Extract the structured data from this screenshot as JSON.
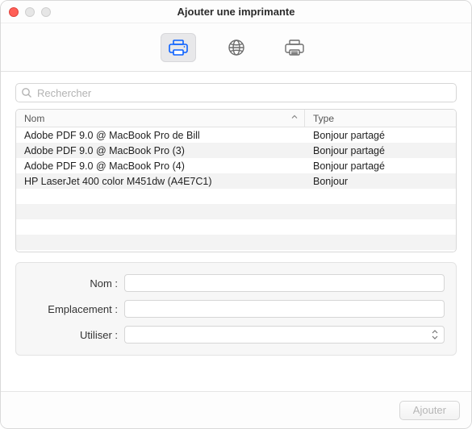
{
  "window": {
    "title": "Ajouter une imprimante"
  },
  "tabs": {
    "default": "default-tab",
    "ip": "ip-tab",
    "windows": "windows-tab"
  },
  "search": {
    "placeholder": "Rechercher"
  },
  "columns": {
    "name": "Nom",
    "type": "Type"
  },
  "printers": [
    {
      "name": "Adobe PDF 9.0 @ MacBook Pro de Bill",
      "type": "Bonjour partagé"
    },
    {
      "name": "Adobe PDF 9.0 @ MacBook Pro (3)",
      "type": "Bonjour partagé"
    },
    {
      "name": "Adobe PDF 9.0 @ MacBook Pro (4)",
      "type": "Bonjour partagé"
    },
    {
      "name": "HP LaserJet 400 color M451dw (A4E7C1)",
      "type": "Bonjour"
    }
  ],
  "form": {
    "name_label": "Nom :",
    "location_label": "Emplacement :",
    "use_label": "Utiliser :",
    "name_value": "",
    "location_value": "",
    "use_value": ""
  },
  "footer": {
    "add_button": "Ajouter"
  }
}
